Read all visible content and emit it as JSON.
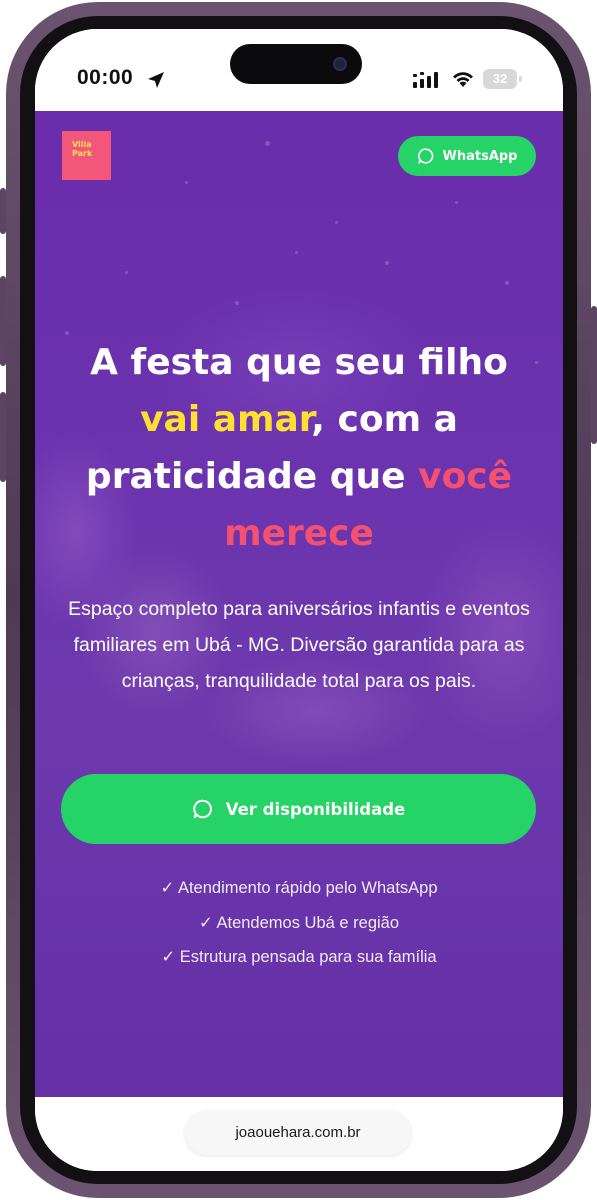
{
  "status_bar": {
    "time": "00:00",
    "battery": "32",
    "icons": [
      "location-arrow-icon",
      "cellular-signal-icon",
      "wifi-icon",
      "battery-icon"
    ]
  },
  "header": {
    "logo_text": [
      "Villa",
      "Park"
    ],
    "whatsapp_label": "WhatsApp"
  },
  "hero": {
    "headline": {
      "part1": "A festa que seu filho",
      "highlight1": "vai amar",
      "part2": ", com a praticidade que",
      "highlight2": "você merece"
    },
    "subtext": "Espaço completo para aniversários infantis e eventos familiares em Ubá - MG. Diversão garantida para as crianças, tranquilidade total para os pais.",
    "cta_label": "Ver disponibilidade",
    "checks": [
      "✓ Atendimento rápido pelo WhatsApp",
      "✓ Atendemos Ubá e região",
      "✓ Estrutura pensada para sua família"
    ]
  },
  "browser": {
    "url": "joaouehara.com.br"
  },
  "colors": {
    "hero_purple": "#6a2dac",
    "whatsapp_green": "#25d366",
    "highlight_yellow": "#ffe032",
    "highlight_pink": "#f4506f",
    "logo_pink": "#f2567b"
  }
}
